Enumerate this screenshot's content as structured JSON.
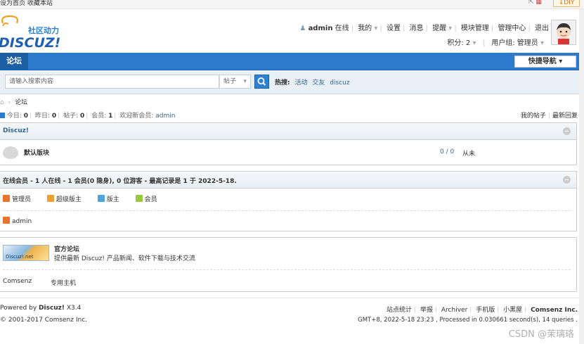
{
  "topbar": {
    "left_text": "设为首页  收藏本站",
    "diy": "↓DIY"
  },
  "logo": {
    "tagline": "社区动力",
    "brand": "DISCUZ!"
  },
  "user": {
    "name": "admin",
    "status": "在线",
    "links": [
      "我的",
      "设置",
      "消息",
      "提醒",
      "模块管理",
      "管理中心",
      "退出"
    ],
    "points": "积分: 2",
    "group": "用户组: 管理员"
  },
  "nav": {
    "tab": "论坛",
    "quicknav": "快捷导航"
  },
  "search": {
    "placeholder": "请输入搜索内容",
    "type": "帖子",
    "hot_label": "热搜:",
    "hot": [
      "活动",
      "交友",
      "discuz"
    ]
  },
  "breadcrumb": {
    "current": "论坛"
  },
  "stats": {
    "today_label": "今日:",
    "today": "0",
    "yesterday_label": "昨日:",
    "yesterday": "0",
    "posts_label": "帖子:",
    "posts": "0",
    "members_label": "会员:",
    "members": "1",
    "welcome_label": "欢迎新会员:",
    "welcome_user": "admin"
  },
  "right_links": [
    "我的帖子",
    "最新回复"
  ],
  "forum_box": {
    "title": "Discuz!",
    "forum_name": "默认版块",
    "count": "0 / 0",
    "last": "从未"
  },
  "online_box": {
    "title": "在线会员 - 1 人在线 - 1 会员(0 隐身), 0 位游客 - 最高记录是 1 于 2022-5-18.",
    "legend": [
      {
        "label": "管理员",
        "color": "#e8732a"
      },
      {
        "label": "超级版主",
        "color": "#f0a030"
      },
      {
        "label": "版主",
        "color": "#4da6e0"
      },
      {
        "label": "会员",
        "color": "#9ac83c"
      }
    ],
    "user": "admin",
    "user_color": "#e8732a"
  },
  "links_box": {
    "banner_text": "Discuz!.net",
    "name": "官方论坛",
    "desc": "提供最新 Discuz! 产品新闻、软件下载与技术交流",
    "friends": [
      "Comsenz",
      "专用主机"
    ]
  },
  "footer": {
    "powered_prefix": "Powered by ",
    "powered_brand": "Discuz!",
    "version": " X3.4",
    "copyright": "© 2001-2017 Comsenz Inc.",
    "links": [
      "站点统计",
      "举报",
      "Archiver",
      "手机版",
      "小黑屋"
    ],
    "company": "Comsenz Inc.",
    "gmt": "GMT+8, 2022-5-18 23:23 , Processed in 0.030661 second(s), 14 queries ."
  },
  "watermark": "CSDN @茉璃珞"
}
